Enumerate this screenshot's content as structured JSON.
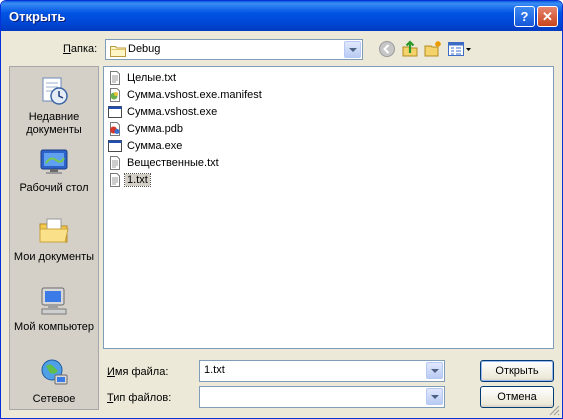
{
  "window": {
    "title": "Открыть",
    "help_label": "?",
    "close_label": "✕"
  },
  "toolbar": {
    "folder_label_u": "П",
    "folder_label_rest": "апка:",
    "folder_value": "Debug",
    "icons": [
      "back-icon",
      "up-folder-icon",
      "new-folder-icon",
      "view-menu-icon"
    ]
  },
  "places": [
    {
      "label": "Недавние документы",
      "icon": "recent-documents-icon"
    },
    {
      "label": "Рабочий стол",
      "icon": "desktop-icon"
    },
    {
      "label": "Мои документы",
      "icon": "my-documents-icon"
    },
    {
      "label": "Мой компьютер",
      "icon": "my-computer-icon"
    },
    {
      "label": "Сетевое",
      "icon": "network-icon"
    }
  ],
  "files": [
    {
      "name": "Целые.txt",
      "icon": "text-file-icon",
      "selected": false
    },
    {
      "name": "Сумма.vshost.exe.manifest",
      "icon": "manifest-file-icon",
      "selected": false
    },
    {
      "name": "Сумма.vshost.exe",
      "icon": "exe-file-icon",
      "selected": false
    },
    {
      "name": "Сумма.pdb",
      "icon": "pdb-file-icon",
      "selected": false
    },
    {
      "name": "Сумма.exe",
      "icon": "exe-file-icon",
      "selected": false
    },
    {
      "name": "Вещественные.txt",
      "icon": "text-file-icon",
      "selected": false
    },
    {
      "name": "1.txt",
      "icon": "text-file-icon",
      "selected": true
    }
  ],
  "filename": {
    "label_u": "И",
    "label_rest": "мя файла:",
    "value": "1.txt"
  },
  "filetype": {
    "label_u": "Т",
    "label_rest": "ип файлов:",
    "value": ""
  },
  "buttons": {
    "open": "Открыть",
    "cancel": "Отмена"
  },
  "colors": {
    "titlebar": "#0054e3",
    "dialog_bg": "#ece9d8",
    "field_border": "#7f9db9"
  }
}
